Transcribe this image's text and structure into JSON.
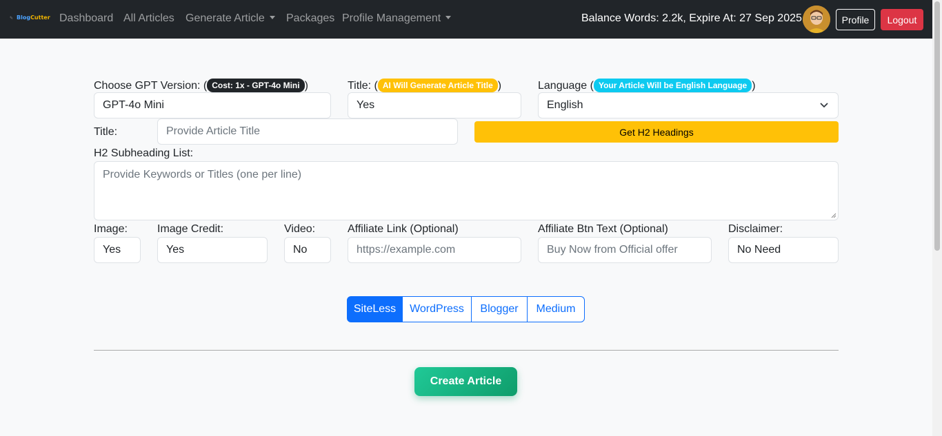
{
  "nav": {
    "brand_name_blog": "Blog",
    "brand_name_cutter": "Cutter",
    "items": [
      {
        "label": "Dashboard"
      },
      {
        "label": "All Articles"
      },
      {
        "label": "Generate Article"
      },
      {
        "label": "Packages"
      },
      {
        "label": "Profile Management"
      }
    ],
    "balance_text": "Balance Words: 2.2k,  Expire At: 27 Sep 2025,",
    "profile_label": "Profile",
    "logout_label": "Logout"
  },
  "form": {
    "gpt": {
      "label": "Choose GPT Version: (",
      "badge": "Cost: 1x - GPT-4o Mini",
      "close": ")",
      "value": "GPT-4o Mini"
    },
    "title_mode": {
      "label": "Title: (",
      "badge": "AI Will Generate Article Title",
      "close": ")",
      "value": "Yes"
    },
    "language": {
      "label": "Language (",
      "badge": "Your Article Will be English Language",
      "close": ")",
      "value": "English"
    },
    "title": {
      "label": "Title:",
      "placeholder": "Provide Article Title"
    },
    "h2_button": "Get H2 Headings",
    "h2_list": {
      "label": "H2 Subheading List:",
      "placeholder": "Provide Keywords or Titles (one per line)"
    },
    "image": {
      "label": "Image:",
      "value": "Yes"
    },
    "image_credit": {
      "label": "Image Credit:",
      "value": "Yes"
    },
    "video": {
      "label": "Video:",
      "value": "No"
    },
    "affiliate_link": {
      "label": "Affiliate Link (Optional)",
      "placeholder": "https://example.com"
    },
    "affiliate_btn": {
      "label": "Affiliate Btn Text (Optional)",
      "placeholder": "Buy Now from Official offer"
    },
    "disclaimer": {
      "label": "Disclaimer:",
      "value": "No Need"
    }
  },
  "platforms": {
    "selected": "SiteLess",
    "options": [
      "SiteLess",
      "WordPress",
      "Blogger",
      "Medium"
    ]
  },
  "create_button": "Create Article",
  "colors": {
    "navbar": "#212529",
    "primary": "#0d6efd",
    "warning": "#ffc107",
    "danger": "#dc3545",
    "info": "#0dcaf0",
    "success": "#20c997"
  }
}
